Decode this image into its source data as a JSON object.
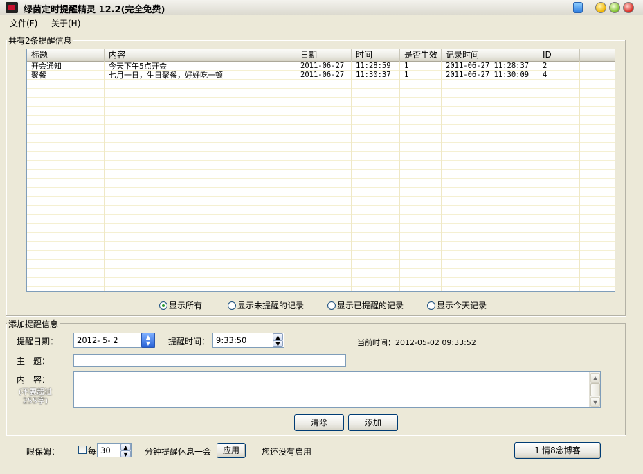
{
  "window": {
    "title": "绿茵定时提醒精灵 12.2(完全免费)"
  },
  "menu": [
    {
      "label": "文件(F)"
    },
    {
      "label": "关于(H)"
    }
  ],
  "records_group": {
    "title": "共有2条提醒信息",
    "columns": [
      "标题",
      "内容",
      "日期",
      "时间",
      "是否生效",
      "记录时间",
      "ID"
    ],
    "rows": [
      [
        "开会通知",
        "今天下午5点开会",
        "2011-06-27",
        "11:28:59",
        "1",
        "2011-06-27 11:28:37",
        "2"
      ],
      [
        "聚餐",
        "七月一日，生日聚餐，好好吃一顿",
        "2011-06-27",
        "11:30:37",
        "1",
        "2011-06-27 11:30:09",
        "4"
      ]
    ]
  },
  "filters": [
    {
      "label": "显示所有",
      "selected": true
    },
    {
      "label": "显示未提醒的记录",
      "selected": false
    },
    {
      "label": "显示已提醒的记录",
      "selected": false
    },
    {
      "label": "显示今天记录",
      "selected": false
    }
  ],
  "add_group": {
    "title": "添加提醒信息",
    "date_label": "提醒日期：",
    "date_value": "2012- 5- 2",
    "time_label": "提醒时间：",
    "time_value": "9:33:50",
    "current_time": "当前时间：2012-05-02 09:33:52",
    "subject_label": "主　题：",
    "subject_value": "",
    "content_label": "内　容：",
    "content_hint": "(不要超过255字)",
    "content_value": "",
    "clear_label": "清除",
    "add_label": "添加"
  },
  "eye_care": {
    "label": "眼保姆：",
    "every_label": "每",
    "minutes_value": "30",
    "suffix": "分钟提醒休息一会",
    "apply_label": "应用",
    "status": "您还没有启用",
    "blog_label": "1'情8念博客"
  },
  "colors": {
    "window_bg": "#ece9d8",
    "grid_line": "#f5f0d2",
    "input_border": "#7f9db9"
  }
}
